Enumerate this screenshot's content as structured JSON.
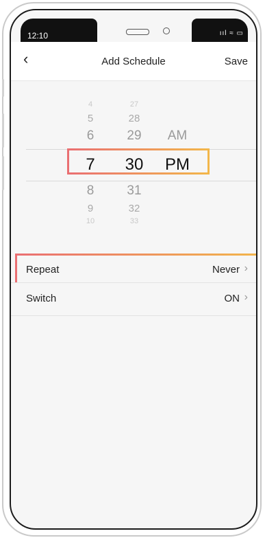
{
  "status_bar": {
    "time": "12:10",
    "icons": "ııl ≈ ▭"
  },
  "header": {
    "back_glyph": "‹",
    "title": "Add Schedule",
    "save_label": "Save"
  },
  "picker": {
    "hours": [
      "4",
      "5",
      "6",
      "7",
      "8",
      "9",
      "10"
    ],
    "minutes": [
      "27",
      "28",
      "29",
      "30",
      "31",
      "32",
      "33"
    ],
    "periods": [
      "AM",
      "PM"
    ],
    "selected": {
      "hour": "7",
      "minute": "30",
      "period": "PM"
    }
  },
  "settings": [
    {
      "label": "Repeat",
      "value": "Never",
      "chevron": "›"
    },
    {
      "label": "Switch",
      "value": "ON",
      "chevron": "›"
    }
  ],
  "colors": {
    "highlight_start": "#ea6f72",
    "highlight_end": "#f2b64a",
    "background": "#f6f6f6"
  }
}
